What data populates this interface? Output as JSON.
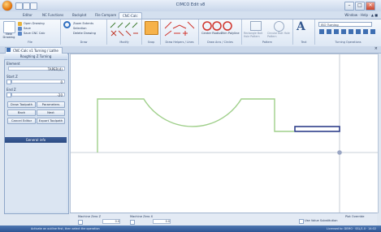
{
  "app": {
    "title": "CIMCO Edit v8"
  },
  "window_buttons": {
    "minimize": "–",
    "maximize": "□",
    "close": "✕"
  },
  "tabs": [
    "Editor",
    "NC Functions",
    "Backplot",
    "File Compare",
    "CNC-Calc"
  ],
  "ribbon_right": "Window · Help · ▲ ■",
  "ribbon": {
    "groups": [
      "File",
      "Draw",
      "Modify",
      "Snap",
      "Draw Helpers / Lines",
      "Draw Arcs / Circles",
      "Pattern",
      "Text",
      "Turning Operations"
    ],
    "file": {
      "new_label": "New Drawing",
      "items": [
        "Open Drawing",
        "Save",
        "Save CNC Calc"
      ]
    },
    "draw": {
      "items": [
        "Zoom Extents",
        "Selection",
        "Delete Drawing"
      ]
    },
    "helpers": {
      "center_label": "Center Radius",
      "trim_label": "Trim Polyline"
    },
    "pattern": {
      "items": [
        "Rectangle Bolt Hole Pattern",
        "Circular Bolt Hole Pattern"
      ]
    },
    "turning": {
      "dropdown_value": "ISO Turning"
    }
  },
  "doc_tab": "CNC-Calc v1 Turning / Lathe",
  "panel": {
    "title": "Roughing Z Turning",
    "element_label": "Element",
    "element_value": "TAPER(4)",
    "start_label": "Start Z",
    "start_value": "0",
    "end_label": "End Z",
    "end_value": "-20",
    "buttons": [
      "Draw Toolpath",
      "Parameters",
      "Back",
      "Next",
      "Cancel Editor",
      "Export Toolpath"
    ],
    "general_header": "General info"
  },
  "bottom": {
    "machine_x_label": "Machine Zero Z",
    "machine_x_value": "0.0",
    "machine_y_label": "Machine Zero X",
    "machine_y_value": "0.0",
    "plot_label": "Plot Override",
    "substitution_label": "Use Value Substitution"
  },
  "status": {
    "left": "Activate an outline first, then select the operation",
    "right": "Licensed to: DEMO · SSL/1.0 · 14:02"
  }
}
